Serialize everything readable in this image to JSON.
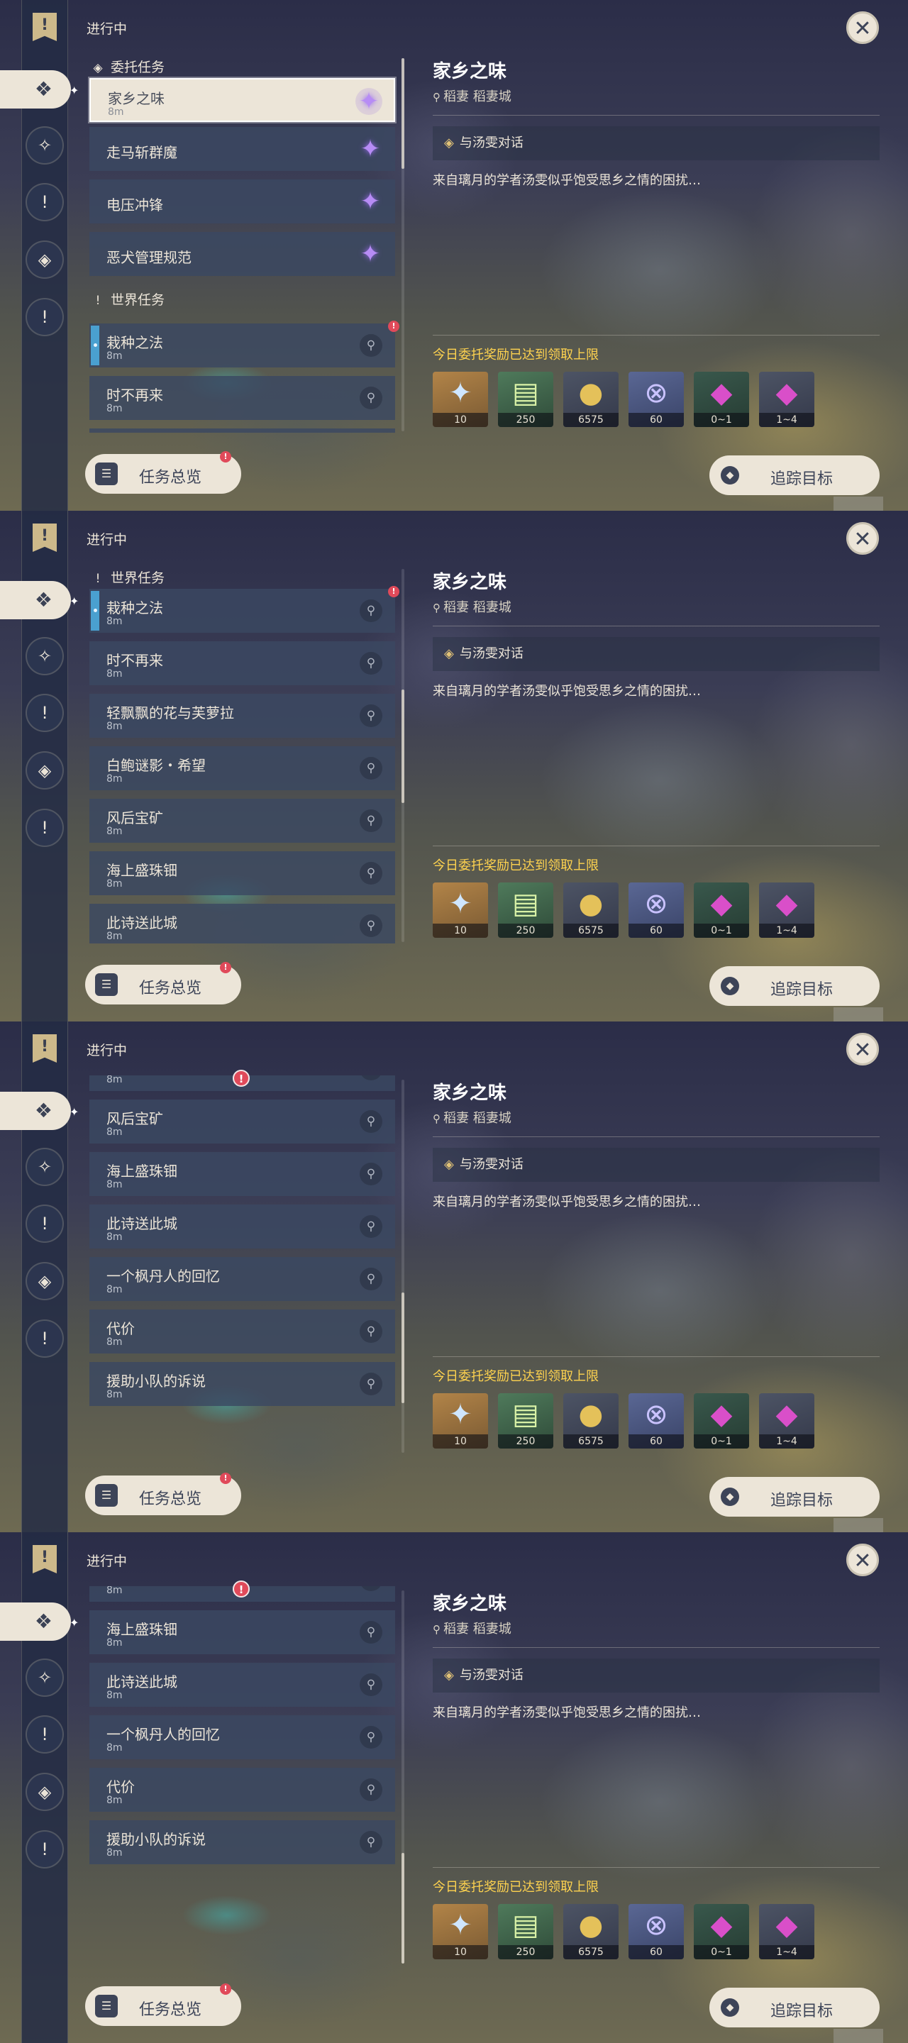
{
  "header": {
    "section_title": "进行中"
  },
  "groups": {
    "commission": "委托任务",
    "world": "世界任务"
  },
  "quests": [
    {
      "name": "家乡之味",
      "distance": "8m"
    },
    {
      "name": "走马斩群魔"
    },
    {
      "name": "电压冲锋"
    },
    {
      "name": "恶犬管理规范"
    },
    {
      "name": "栽种之法",
      "distance": "8m"
    },
    {
      "name": "时不再来",
      "distance": "8m"
    },
    {
      "name": "轻飘飘的花与芙萝拉",
      "distance": "8m"
    },
    {
      "name": "白鲍谜影・希望",
      "distance": "8m"
    },
    {
      "name": "风后宝矿",
      "distance": "8m"
    },
    {
      "name": "海上盛珠钿",
      "distance": "8m"
    },
    {
      "name": "此诗送此城",
      "distance": "8m"
    },
    {
      "name": "一个枫丹人的回忆",
      "distance": "8m"
    },
    {
      "name": "代价",
      "distance": "8m"
    },
    {
      "name": "援助小队的诉说",
      "distance": "8m"
    }
  ],
  "detail": {
    "title": "家乡之味",
    "location": "稻妻 稻妻城",
    "step": "与汤雯对话",
    "description": "来自璃月的学者汤雯似乎饱受思乡之情的困扰…",
    "reward_title": "今日委托奖励已达到领取上限",
    "rewards": [
      {
        "icon": "primogem-icon",
        "count": "10"
      },
      {
        "icon": "exp-book-icon",
        "count": "250"
      },
      {
        "icon": "mora-icon",
        "count": "6575"
      },
      {
        "icon": "fate-link-icon",
        "count": "60"
      },
      {
        "icon": "crystal-small-icon",
        "count": "0~1"
      },
      {
        "icon": "crystal-large-icon",
        "count": "1~4"
      }
    ]
  },
  "buttons": {
    "overview": "任务总览",
    "track": "追踪目标"
  },
  "badges": {
    "alert": "!"
  },
  "colors": {
    "accent_gold": "#e2c377",
    "reward_title": "#ffd34f",
    "alert_red": "#e04a5a",
    "tracked_blue": "#4aa0d0",
    "cream": "#ece5d8"
  }
}
